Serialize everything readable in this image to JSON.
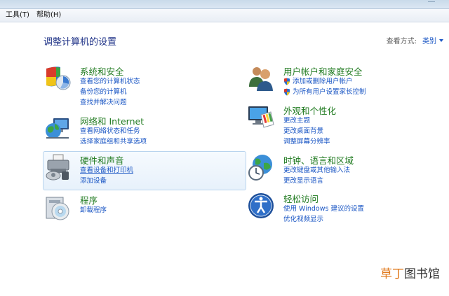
{
  "menu": [
    {
      "label": "工具(T)"
    },
    {
      "label": "帮助(H)"
    }
  ],
  "page_title": "调整计算机的设置",
  "view_by": {
    "label": "查看方式:",
    "value": "类别"
  },
  "categories": [
    {
      "title": "系统和安全",
      "icon": "shield-security-icon",
      "links": [
        "查看您的计算机状态",
        "备份您的计算机",
        "查找并解决问题"
      ]
    },
    {
      "title": "网络和 Internet",
      "icon": "network-globe-icon",
      "links": [
        "查看网络状态和任务",
        "选择家庭组和共享选项"
      ]
    },
    {
      "title": "硬件和声音",
      "icon": "printer-hardware-icon",
      "links": [
        "查看设备和打印机",
        "添加设备"
      ]
    },
    {
      "title": "程序",
      "icon": "programs-disc-icon",
      "links": [
        "卸载程序"
      ]
    },
    {
      "title": "用户帐户和家庭安全",
      "icon": "users-icon",
      "links": [
        "添加或删除用户帐户",
        "为所有用户设置家长控制"
      ]
    },
    {
      "title": "外观和个性化",
      "icon": "monitor-palette-icon",
      "links": [
        "更改主题",
        "更改桌面背景",
        "调整屏幕分辨率"
      ]
    },
    {
      "title": "时钟、语言和区域",
      "icon": "clock-globe-icon",
      "links": [
        "更改键盘或其他输入法",
        "更改显示语言"
      ]
    },
    {
      "title": "轻松访问",
      "icon": "ease-of-access-icon",
      "links": [
        "使用 Windows 建议的设置",
        "优化视频显示"
      ]
    }
  ],
  "watermark": {
    "part1": "草丁",
    "part2": "图书馆"
  }
}
